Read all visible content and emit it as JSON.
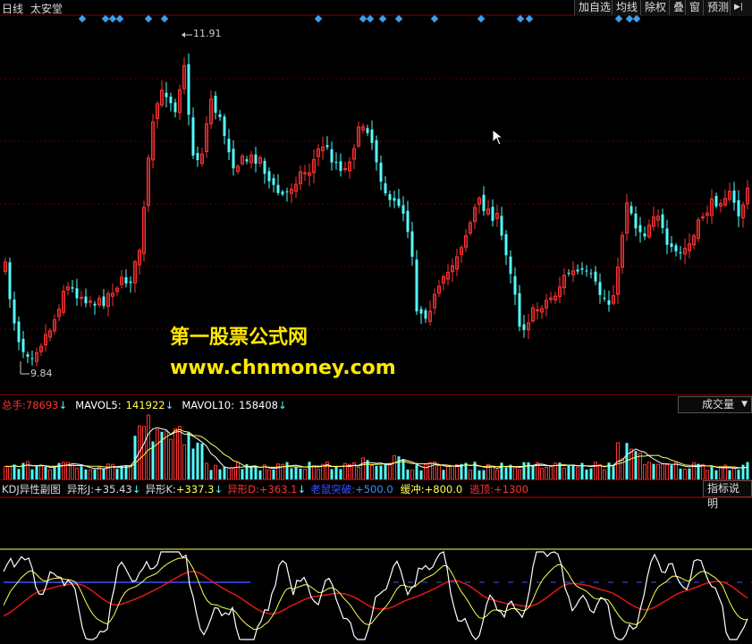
{
  "header": {
    "period": "日线",
    "stock_name": "太安堂",
    "buttons": [
      "加自选",
      "均线",
      "除权",
      "叠",
      "窗",
      "预测"
    ],
    "nav_icon": "skip-end-icon"
  },
  "price_chart": {
    "high_label": "11.91",
    "low_label": "9.84",
    "colors": {
      "up": "#ff3232",
      "down": "#54fcfc",
      "grid": "#5a0000",
      "marker": "#3aa0f0"
    }
  },
  "watermark": {
    "line1": "第一股票公式网",
    "line2": "www.chnmoney.com"
  },
  "volume_panel": {
    "total_label": "总手:",
    "total_value": "78693",
    "mavol5_label": "MAVOL5:",
    "mavol5_value": "141922",
    "mavol10_label": "MAVOL10:",
    "mavol10_value": "158408",
    "selector": "成交量"
  },
  "indicator_panel": {
    "name": "KDJ异性副图",
    "j_label": "异形J:",
    "j_value": "+35.43",
    "k_label": "异形K:",
    "k_value": "+337.3",
    "d_label": "异形D:",
    "d_value": "+363.1",
    "breakout_label": "老鼠突破:",
    "breakout_value": "+500.0",
    "buffer_label": "缓冲:",
    "buffer_value": "+800.0",
    "top_label": "逃顶:",
    "top_value": "+1300",
    "help_button": "指标说明"
  }
}
